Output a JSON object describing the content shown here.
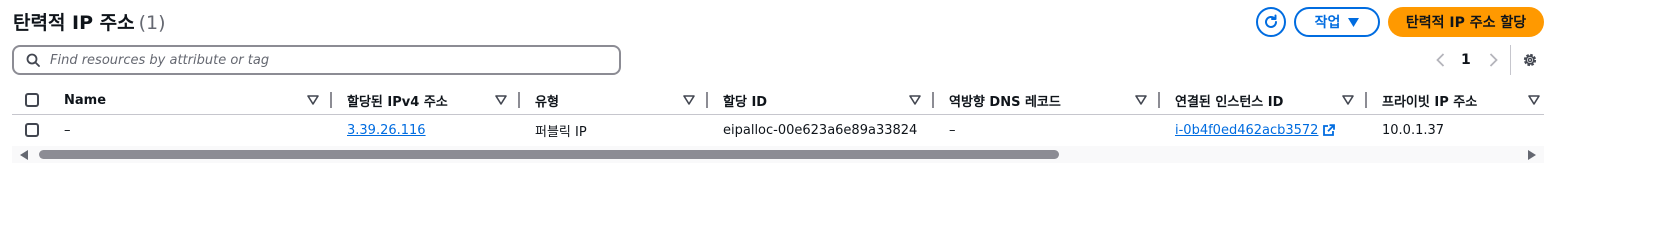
{
  "header": {
    "title": "탄력적 IP 주소",
    "count": "(1)",
    "actions_label": "작업",
    "primary_label": "탄력적 IP 주소 할당"
  },
  "search": {
    "placeholder": "Find resources by attribute or tag"
  },
  "pagination": {
    "current_page": "1"
  },
  "table": {
    "columns": [
      {
        "label": "Name"
      },
      {
        "label": "할당된 IPv4 주소"
      },
      {
        "label": "유형"
      },
      {
        "label": "할당 ID"
      },
      {
        "label": "역방향 DNS 레코드"
      },
      {
        "label": "연결된 인스턴스 ID"
      },
      {
        "label": "프라이빗 IP 주소"
      }
    ],
    "rows": [
      {
        "name": "–",
        "ipv4": "3.39.26.116",
        "type": "퍼블릭 IP",
        "allocation_id": "eipalloc-00e623a6e89a33824",
        "reverse_dns": "–",
        "instance_id": "i-0b4f0ed462acb3572",
        "private_ip": "10.0.1.37"
      }
    ]
  },
  "colors": {
    "accent": "#006ce0",
    "primary": "#ff9900",
    "text": "#0f141a",
    "border": "#8c8c94"
  }
}
